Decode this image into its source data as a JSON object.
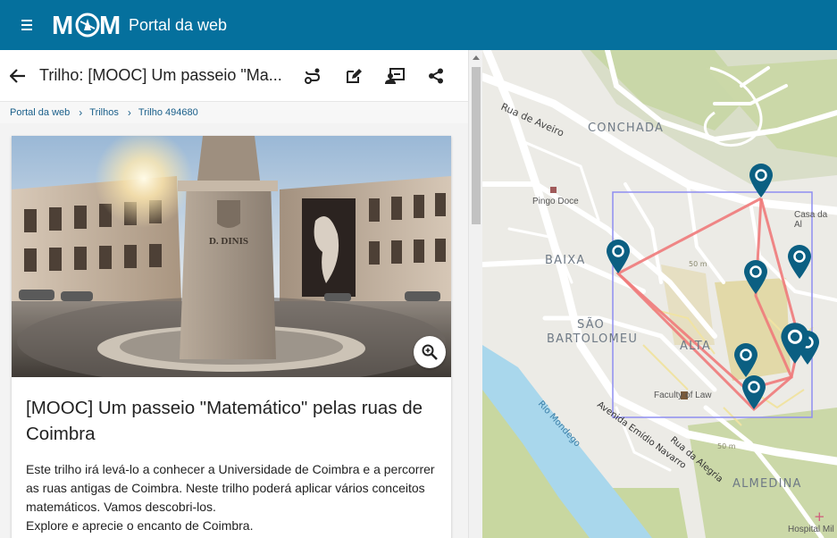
{
  "header": {
    "brand": "Portal da web",
    "logo_text": "MCM"
  },
  "trail": {
    "title": "Trilho: [MOOC] Um passeio \"Ma...",
    "breadcrumbs": [
      "Portal da web",
      "Trilhos",
      "Trilho 494680"
    ],
    "card_title": "[MOOC] Um passeio \"Matemático\" pelas ruas de Coimbra",
    "description": [
      "Este trilho irá levá-lo a conhecer a Universidade de Coimbra e a percorrer as ruas antigas de Coimbra. Neste trilho poderá aplicar vários conceitos matemáticos. Vamos descobri-los.",
      "Explore e aprecie o encanto de Coimbra."
    ],
    "photo_inscription": "D. DINIS"
  },
  "icons": {
    "menu": "menu-icon",
    "back": "arrow-left-icon",
    "route": "route-icon",
    "edit": "edit-icon",
    "cast": "present-icon",
    "share": "share-icon",
    "zoom": "zoom-in-icon"
  },
  "map": {
    "areas": [
      "CONCHADA",
      "BAIXA",
      "SÃO",
      "BARTOLOMEU",
      "ALTA",
      "ALMEDINA"
    ],
    "streets": [
      "Rua de Aveiro",
      "Rio Mondego",
      "Avenida Emídio Navarro",
      "Rua da Alegria"
    ],
    "pois": [
      "Pingo Doce",
      "Casa da Al",
      "Faculty of Law",
      "Hospital Mil"
    ],
    "contours": [
      "50 m",
      "50 m"
    ],
    "marker_count": 8
  },
  "colors": {
    "header": "#05709d",
    "marker": "#0b5f82",
    "route": "#f07a7a",
    "bbox": "#8e8ef0",
    "river": "#a9d7ec"
  }
}
